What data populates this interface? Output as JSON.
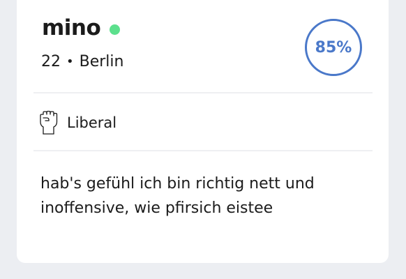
{
  "profile": {
    "name": "mino",
    "online_color": "#5ce08d",
    "age": "22",
    "separator": "•",
    "city": "Berlin",
    "match_percent": "85%",
    "match_color": "#4a78c9",
    "politics_icon": "raised-fist-icon",
    "politics_label": "Liberal",
    "bio": "hab's gefühl ich bin richtig nett und inoffensive, wie pfirsich eistee"
  }
}
